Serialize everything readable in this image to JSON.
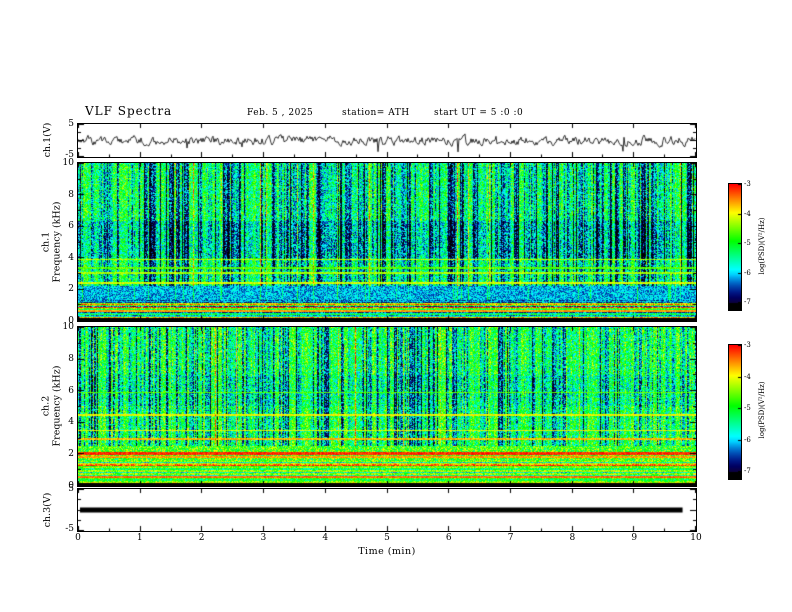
{
  "title": "VLF Spectra",
  "header": {
    "date": "Feb. 5  , 2025",
    "station": "station= ATH",
    "start_ut": "start UT =  5 :0 :0"
  },
  "xaxis": {
    "label": "Time  (min)",
    "tick_labels": [
      "0",
      "1",
      "2",
      "3",
      "4",
      "5",
      "6",
      "7",
      "8",
      "9",
      "10"
    ],
    "range": [
      0,
      10
    ]
  },
  "colorbar": {
    "label": "log(PSD)(V²/Hz)",
    "tick_labels": [
      "-3",
      "-4",
      "-5",
      "-6",
      "-7"
    ],
    "range": [
      -3,
      -7
    ]
  },
  "panels": {
    "ch1_waveform": {
      "ylabel": "ch.1(V)",
      "ytick_top": "5",
      "ytick_bottom": "-5",
      "yrange": [
        -5,
        5
      ]
    },
    "ch1_spectrogram": {
      "ylabel_channel": "ch.1",
      "ylabel_axis": "Frequency  (kHz)",
      "ytick_labels": [
        "10",
        "8",
        "6",
        "4",
        "2",
        "0"
      ],
      "yrange_khz": [
        0,
        10
      ]
    },
    "ch2_spectrogram": {
      "ylabel_channel": "ch.2",
      "ylabel_axis": "Frequency  (kHz)",
      "ytick_labels": [
        "10",
        "8",
        "6",
        "4",
        "2",
        "0"
      ],
      "yrange_khz": [
        0,
        10
      ]
    },
    "ch3_waveform": {
      "ylabel": "ch.3(V)",
      "ytick_top": "5",
      "ytick_bottom": "-5",
      "yrange": [
        -5,
        5
      ]
    }
  },
  "chart_data": [
    {
      "type": "line",
      "name": "ch1_waveform",
      "ylabel": "ch.1(V)",
      "xlabel": "Time (min)",
      "xlim": [
        0,
        10
      ],
      "ylim": [
        -5,
        5
      ],
      "description": "Broadband noisy voltage trace centred on 0 V, rms about 0.8 V, with frequent sharp spikes reaching about -4 V and +3 V over the whole 0-10 min record",
      "render_params": {
        "seed": 777,
        "flat": false
      }
    },
    {
      "type": "heatmap",
      "name": "ch1_spectrogram",
      "xlabel": "Time (min)",
      "ylabel": "Frequency (kHz)",
      "xlim": [
        0,
        10
      ],
      "ylim": [
        0,
        10
      ],
      "zlabel": "log(PSD)(V²/Hz)",
      "zlim": [
        -7,
        -3
      ],
      "features": [
        "speckled green/cyan background near -5",
        "dense vertical dark-blue dropout stripes above about 2.2 kHz through the whole record",
        "continuous dark-blue quiet band 1.25-2.2 kHz",
        "dense multicoloured horizontal harmonic lines below 1.3 kHz",
        "narrow green-yellow horizontal lines near 2.4, 3.0, 3.35 and 3.9 kHz",
        "slightly darker region 4-6.3 kHz",
        "black under-range strip at 0 kHz"
      ],
      "render_params": {
        "seed": 911,
        "base": -4.95,
        "stripe_min_khz": 2.2,
        "dark_band": [
          1.25,
          2.2
        ],
        "low_band": [
          0.18,
          1.3
        ],
        "low_base": -6.6,
        "low_span": 3.4,
        "mid_dip": [
          4.0,
          6.3,
          0.45
        ],
        "hlines": [
          {
            "f": 2.42,
            "v": -4.1,
            "w": 0.06
          },
          {
            "f": 3.02,
            "v": -4.3,
            "w": 0.05
          },
          {
            "f": 3.35,
            "v": -4.6,
            "w": 0.04
          },
          {
            "f": 3.88,
            "v": -4.25,
            "w": 0.05
          },
          {
            "f": 0.62,
            "v": -3.6,
            "w": 0.05
          }
        ]
      }
    },
    {
      "type": "heatmap",
      "name": "ch2_spectrogram",
      "xlabel": "Time (min)",
      "ylabel": "Frequency (kHz)",
      "xlim": [
        0,
        10
      ],
      "ylim": [
        0,
        10
      ],
      "zlabel": "log(PSD)(V²/Hz)",
      "zlim": [
        -7,
        -3
      ],
      "features": [
        "brighter green background near -4.75",
        "vertical dark-blue dropout stripes above about 2.5 kHz",
        "strong red/orange horizontal lines near 1.85-2.1 kHz",
        "orange/yellow lines near 1.45, 2.95, 3.5 and 4.45 kHz",
        "noisy mixed harmonic lines below about 1.55 kHz",
        "black under-range strip at 0 kHz"
      ],
      "render_params": {
        "seed": 2025,
        "base": -4.75,
        "stripe_min_khz": 2.5,
        "dark_band": null,
        "low_band": [
          0.18,
          1.55
        ],
        "low_base": -6.2,
        "low_span": 3.2,
        "mid_dip": [
          5.0,
          7.0,
          0.25
        ],
        "hlines": [
          {
            "f": 2.05,
            "v": -3.15,
            "w": 0.07
          },
          {
            "f": 1.83,
            "v": -3.6,
            "w": 0.05
          },
          {
            "f": 2.95,
            "v": -3.7,
            "w": 0.05
          },
          {
            "f": 3.5,
            "v": -4.05,
            "w": 0.04
          },
          {
            "f": 4.45,
            "v": -4.0,
            "w": 0.05
          },
          {
            "f": 5.9,
            "v": -4.6,
            "w": 0.04
          },
          {
            "f": 0.55,
            "v": -3.4,
            "w": 0.05
          }
        ]
      }
    },
    {
      "type": "line",
      "name": "ch3_waveform",
      "ylabel": "ch.3(V)",
      "xlabel": "Time (min)",
      "xlim": [
        0,
        10
      ],
      "ylim": [
        -5,
        5
      ],
      "description": "Flat thick black line at 0 V for the whole record (no signal on channel 3)",
      "render_params": {
        "seed": 3,
        "flat": true
      }
    }
  ]
}
